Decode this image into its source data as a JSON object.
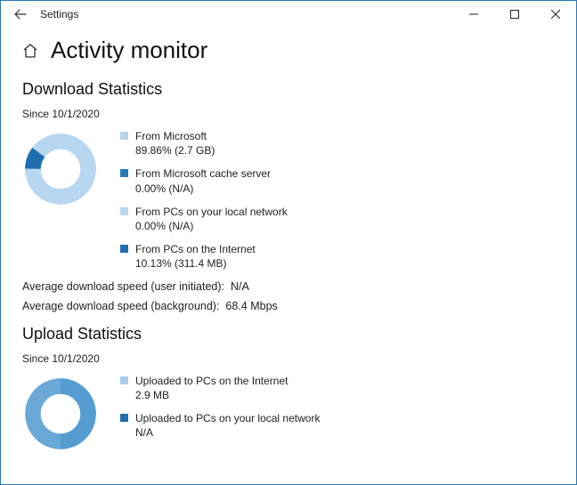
{
  "window": {
    "title": "Settings"
  },
  "page": {
    "title": "Activity monitor"
  },
  "download": {
    "heading": "Download Statistics",
    "since_label": "Since 10/1/2020",
    "items": [
      {
        "label": "From Microsoft",
        "value": "89.86%  (2.7 GB)",
        "color": "#b7d6f0"
      },
      {
        "label": "From Microsoft cache server",
        "value": "0.00%  (N/A)",
        "color": "#2a7ab8"
      },
      {
        "label": "From PCs on your local network",
        "value": "0.00%  (N/A)",
        "color": "#b7d6f0"
      },
      {
        "label": "From PCs on the Internet",
        "value": "10.13%  (311.4 MB)",
        "color": "#1f6fb0"
      }
    ],
    "avg_user_label": "Average download speed (user initiated):",
    "avg_user_value": "N/A",
    "avg_bg_label": "Average download speed (background):",
    "avg_bg_value": "68.4 Mbps"
  },
  "upload": {
    "heading": "Upload Statistics",
    "since_label": "Since 10/1/2020",
    "items": [
      {
        "label": "Uploaded to PCs on the Internet",
        "value": "2.9 MB",
        "color": "#a9cdea"
      },
      {
        "label": "Uploaded to PCs on your local network",
        "value": "N/A",
        "color": "#1f6fb0"
      }
    ]
  },
  "chart_data": [
    {
      "type": "pie",
      "title": "Download Statistics",
      "categories": [
        "From Microsoft",
        "From Microsoft cache server",
        "From PCs on your local network",
        "From PCs on the Internet"
      ],
      "values": [
        89.86,
        0.0,
        0.0,
        10.13
      ],
      "size_labels": [
        "2.7 GB",
        "N/A",
        "N/A",
        "311.4 MB"
      ],
      "colors": [
        "#b7d6f0",
        "#2a7ab8",
        "#b7d6f0",
        "#1f6fb0"
      ]
    },
    {
      "type": "pie",
      "title": "Upload Statistics",
      "categories": [
        "Uploaded to PCs on the Internet",
        "Uploaded to PCs on your local network"
      ],
      "values": [
        100,
        0
      ],
      "size_labels": [
        "2.9 MB",
        "N/A"
      ],
      "colors": [
        "#a9cdea",
        "#1f6fb0"
      ]
    }
  ]
}
